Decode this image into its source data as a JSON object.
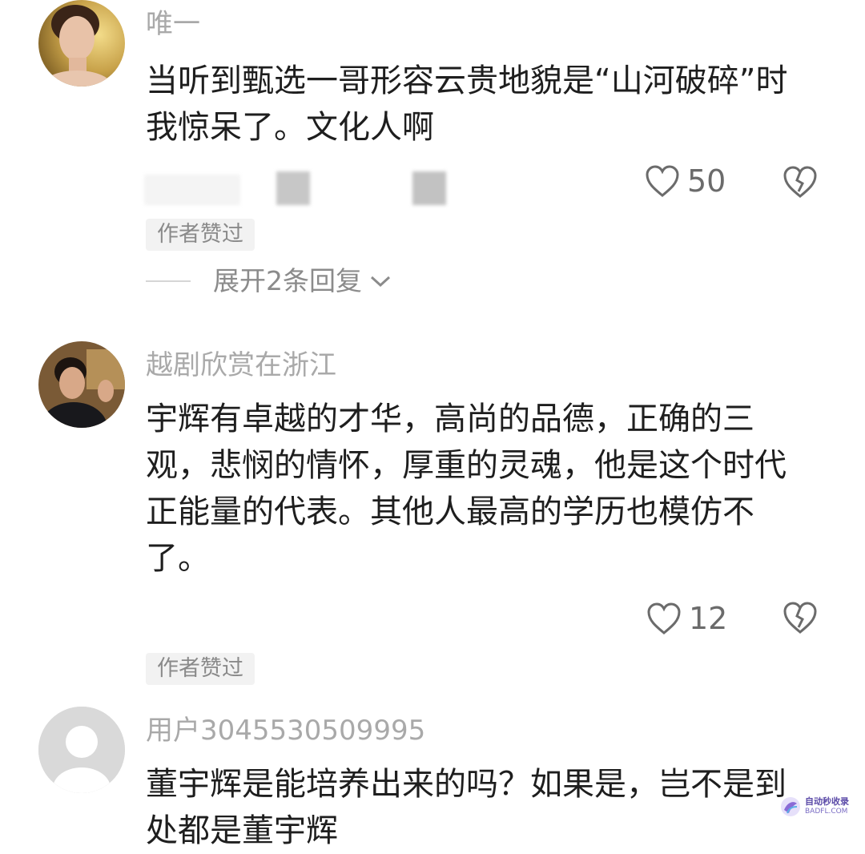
{
  "comments": [
    {
      "username": "唯一",
      "text": "当听到甄选一哥形容云贵地貌是“山河破碎”时我惊呆了。文化人啊",
      "likes": "50",
      "badge": "作者赞过",
      "expand_label": "展开2条回复"
    },
    {
      "username": "越剧欣赏在浙江",
      "text": "宇辉有卓越的才华，高尚的品德，正确的三观，悲悯的情怀，厚重的灵魂，他是这个时代正能量的代表。其他人最高的学历也模仿不了。",
      "likes": "12",
      "badge": "作者赞过"
    },
    {
      "username": "用户3045530509995",
      "text": "董宇辉是能培养出来的吗？如果是，岂不是到处都是董宇辉"
    }
  ],
  "watermark": {
    "main": "自动秒收录",
    "sub": "BADFL.COM"
  },
  "colors": {
    "username": "#a9a9a9",
    "text": "#1e1e1e",
    "meta": "#8a8a8a",
    "badge_bg": "#f2f2f2"
  },
  "icons": [
    "heart-outline-icon",
    "broken-heart-icon",
    "chevron-down-icon"
  ]
}
